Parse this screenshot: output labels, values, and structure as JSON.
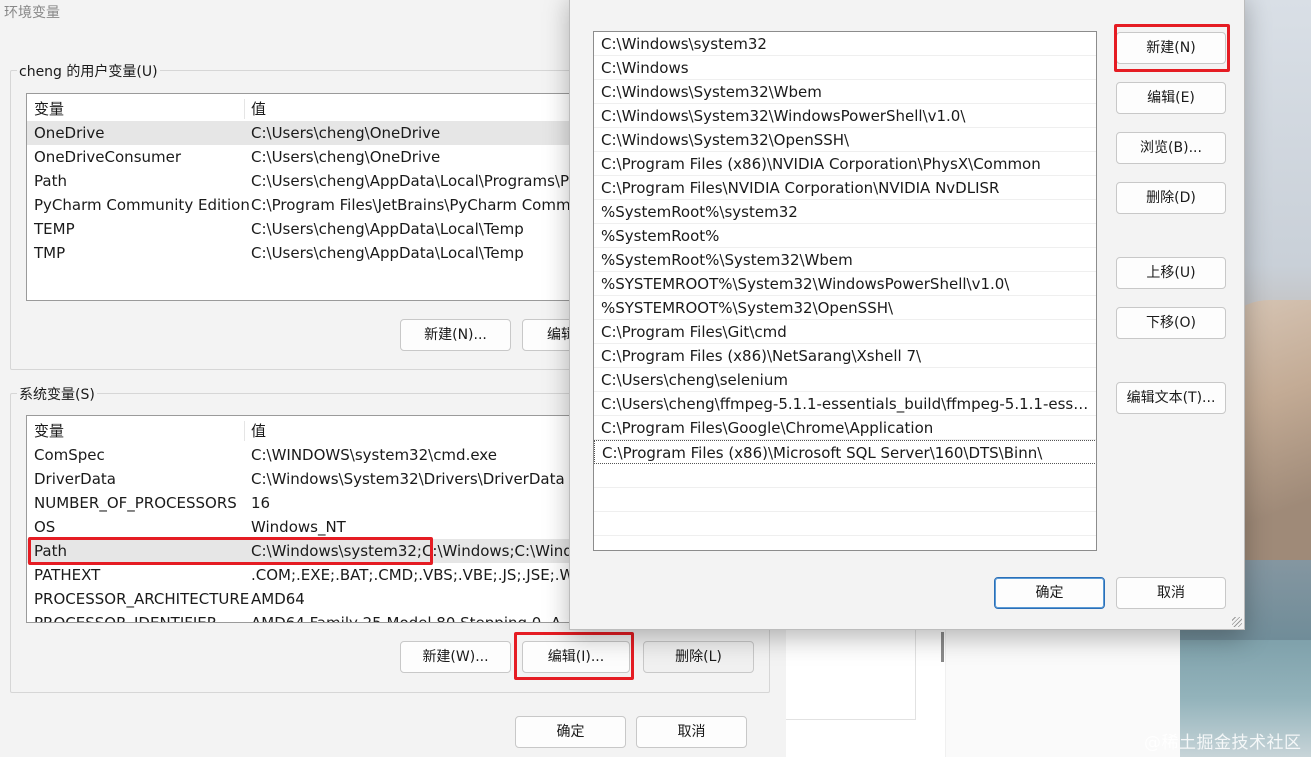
{
  "env_dialog": {
    "title": "环境变量",
    "user_group_label": "cheng 的用户变量(U)",
    "system_group_label": "系统变量(S)",
    "columns": {
      "variable": "变量",
      "value": "值"
    },
    "user_vars": [
      {
        "name": "OneDrive",
        "value": "C:\\Users\\cheng\\OneDrive"
      },
      {
        "name": "OneDriveConsumer",
        "value": "C:\\Users\\cheng\\OneDrive"
      },
      {
        "name": "Path",
        "value": "C:\\Users\\cheng\\AppData\\Local\\Programs\\Py"
      },
      {
        "name": "PyCharm Community Edition",
        "value": "C:\\Program Files\\JetBrains\\PyCharm Commu"
      },
      {
        "name": "TEMP",
        "value": "C:\\Users\\cheng\\AppData\\Local\\Temp"
      },
      {
        "name": "TMP",
        "value": "C:\\Users\\cheng\\AppData\\Local\\Temp"
      }
    ],
    "system_vars": [
      {
        "name": "ComSpec",
        "value": "C:\\WINDOWS\\system32\\cmd.exe"
      },
      {
        "name": "DriverData",
        "value": "C:\\Windows\\System32\\Drivers\\DriverData"
      },
      {
        "name": "NUMBER_OF_PROCESSORS",
        "value": "16"
      },
      {
        "name": "OS",
        "value": "Windows_NT"
      },
      {
        "name": "Path",
        "value": "C:\\Windows\\system32;C:\\Windows;C:\\Windo"
      },
      {
        "name": "PATHEXT",
        "value": ".COM;.EXE;.BAT;.CMD;.VBS;.VBE;.JS;.JSE;.WSF"
      },
      {
        "name": "PROCESSOR_ARCHITECTURE",
        "value": "AMD64"
      },
      {
        "name": "PROCESSOR_IDENTIFIER",
        "value": "AMD64 Family 25 Model 80 Stepping 0, A"
      }
    ],
    "user_buttons": {
      "new": "新建(N)...",
      "edit": "编辑"
    },
    "system_buttons": {
      "new": "新建(W)...",
      "edit": "编辑(I)...",
      "delete": "删除(L)"
    },
    "footer_buttons": {
      "ok": "确定",
      "cancel": "取消"
    }
  },
  "edit_dialog": {
    "paths": [
      "C:\\Windows\\system32",
      "C:\\Windows",
      "C:\\Windows\\System32\\Wbem",
      "C:\\Windows\\System32\\WindowsPowerShell\\v1.0\\",
      "C:\\Windows\\System32\\OpenSSH\\",
      "C:\\Program Files (x86)\\NVIDIA Corporation\\PhysX\\Common",
      "C:\\Program Files\\NVIDIA Corporation\\NVIDIA NvDLISR",
      "%SystemRoot%\\system32",
      "%SystemRoot%",
      "%SystemRoot%\\System32\\Wbem",
      "%SYSTEMROOT%\\System32\\WindowsPowerShell\\v1.0\\",
      "%SYSTEMROOT%\\System32\\OpenSSH\\",
      "C:\\Program Files\\Git\\cmd",
      "C:\\Program Files (x86)\\NetSarang\\Xshell 7\\",
      "C:\\Users\\cheng\\selenium",
      "C:\\Users\\cheng\\ffmpeg-5.1.1-essentials_build\\ffmpeg-5.1.1-essen...",
      "C:\\Program Files\\Google\\Chrome\\Application",
      "C:\\Program Files (x86)\\Microsoft SQL Server\\160\\DTS\\Binn\\"
    ],
    "buttons": {
      "new": "新建(N)",
      "edit": "编辑(E)",
      "browse": "浏览(B)...",
      "delete": "删除(D)",
      "move_up": "上移(U)",
      "move_down": "下移(O)",
      "edit_text": "编辑文本(T)...",
      "ok": "确定",
      "cancel": "取消"
    }
  },
  "watermark": "@稀土掘金技术社区",
  "colors": {
    "highlight_red": "#e51c23",
    "selected_row": "#e6e6e6",
    "primary_border": "#2b6fb8"
  }
}
